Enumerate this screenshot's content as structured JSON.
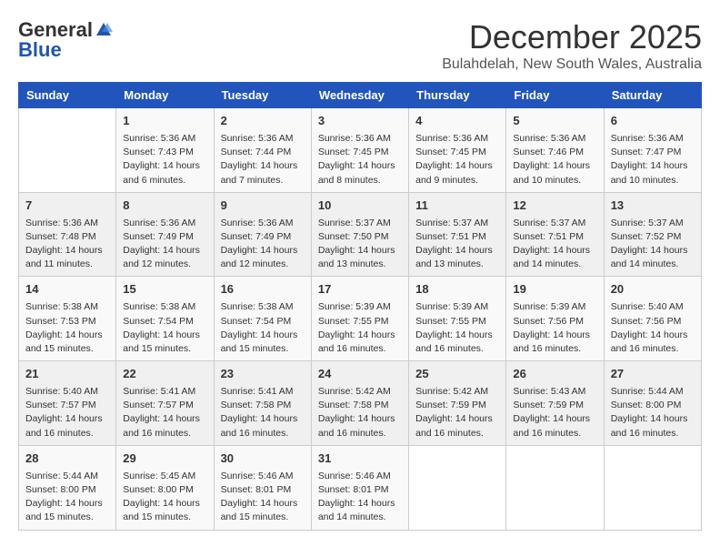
{
  "header": {
    "logo_general": "General",
    "logo_blue": "Blue",
    "month": "December 2025",
    "location": "Bulahdelah, New South Wales, Australia"
  },
  "days_of_week": [
    "Sunday",
    "Monday",
    "Tuesday",
    "Wednesday",
    "Thursday",
    "Friday",
    "Saturday"
  ],
  "weeks": [
    [
      {
        "day": "",
        "content": ""
      },
      {
        "day": "1",
        "content": "Sunrise: 5:36 AM\nSunset: 7:43 PM\nDaylight: 14 hours\nand 6 minutes."
      },
      {
        "day": "2",
        "content": "Sunrise: 5:36 AM\nSunset: 7:44 PM\nDaylight: 14 hours\nand 7 minutes."
      },
      {
        "day": "3",
        "content": "Sunrise: 5:36 AM\nSunset: 7:45 PM\nDaylight: 14 hours\nand 8 minutes."
      },
      {
        "day": "4",
        "content": "Sunrise: 5:36 AM\nSunset: 7:45 PM\nDaylight: 14 hours\nand 9 minutes."
      },
      {
        "day": "5",
        "content": "Sunrise: 5:36 AM\nSunset: 7:46 PM\nDaylight: 14 hours\nand 10 minutes."
      },
      {
        "day": "6",
        "content": "Sunrise: 5:36 AM\nSunset: 7:47 PM\nDaylight: 14 hours\nand 10 minutes."
      }
    ],
    [
      {
        "day": "7",
        "content": "Sunrise: 5:36 AM\nSunset: 7:48 PM\nDaylight: 14 hours\nand 11 minutes."
      },
      {
        "day": "8",
        "content": "Sunrise: 5:36 AM\nSunset: 7:49 PM\nDaylight: 14 hours\nand 12 minutes."
      },
      {
        "day": "9",
        "content": "Sunrise: 5:36 AM\nSunset: 7:49 PM\nDaylight: 14 hours\nand 12 minutes."
      },
      {
        "day": "10",
        "content": "Sunrise: 5:37 AM\nSunset: 7:50 PM\nDaylight: 14 hours\nand 13 minutes."
      },
      {
        "day": "11",
        "content": "Sunrise: 5:37 AM\nSunset: 7:51 PM\nDaylight: 14 hours\nand 13 minutes."
      },
      {
        "day": "12",
        "content": "Sunrise: 5:37 AM\nSunset: 7:51 PM\nDaylight: 14 hours\nand 14 minutes."
      },
      {
        "day": "13",
        "content": "Sunrise: 5:37 AM\nSunset: 7:52 PM\nDaylight: 14 hours\nand 14 minutes."
      }
    ],
    [
      {
        "day": "14",
        "content": "Sunrise: 5:38 AM\nSunset: 7:53 PM\nDaylight: 14 hours\nand 15 minutes."
      },
      {
        "day": "15",
        "content": "Sunrise: 5:38 AM\nSunset: 7:54 PM\nDaylight: 14 hours\nand 15 minutes."
      },
      {
        "day": "16",
        "content": "Sunrise: 5:38 AM\nSunset: 7:54 PM\nDaylight: 14 hours\nand 15 minutes."
      },
      {
        "day": "17",
        "content": "Sunrise: 5:39 AM\nSunset: 7:55 PM\nDaylight: 14 hours\nand 16 minutes."
      },
      {
        "day": "18",
        "content": "Sunrise: 5:39 AM\nSunset: 7:55 PM\nDaylight: 14 hours\nand 16 minutes."
      },
      {
        "day": "19",
        "content": "Sunrise: 5:39 AM\nSunset: 7:56 PM\nDaylight: 14 hours\nand 16 minutes."
      },
      {
        "day": "20",
        "content": "Sunrise: 5:40 AM\nSunset: 7:56 PM\nDaylight: 14 hours\nand 16 minutes."
      }
    ],
    [
      {
        "day": "21",
        "content": "Sunrise: 5:40 AM\nSunset: 7:57 PM\nDaylight: 14 hours\nand 16 minutes."
      },
      {
        "day": "22",
        "content": "Sunrise: 5:41 AM\nSunset: 7:57 PM\nDaylight: 14 hours\nand 16 minutes."
      },
      {
        "day": "23",
        "content": "Sunrise: 5:41 AM\nSunset: 7:58 PM\nDaylight: 14 hours\nand 16 minutes."
      },
      {
        "day": "24",
        "content": "Sunrise: 5:42 AM\nSunset: 7:58 PM\nDaylight: 14 hours\nand 16 minutes."
      },
      {
        "day": "25",
        "content": "Sunrise: 5:42 AM\nSunset: 7:59 PM\nDaylight: 14 hours\nand 16 minutes."
      },
      {
        "day": "26",
        "content": "Sunrise: 5:43 AM\nSunset: 7:59 PM\nDaylight: 14 hours\nand 16 minutes."
      },
      {
        "day": "27",
        "content": "Sunrise: 5:44 AM\nSunset: 8:00 PM\nDaylight: 14 hours\nand 16 minutes."
      }
    ],
    [
      {
        "day": "28",
        "content": "Sunrise: 5:44 AM\nSunset: 8:00 PM\nDaylight: 14 hours\nand 15 minutes."
      },
      {
        "day": "29",
        "content": "Sunrise: 5:45 AM\nSunset: 8:00 PM\nDaylight: 14 hours\nand 15 minutes."
      },
      {
        "day": "30",
        "content": "Sunrise: 5:46 AM\nSunset: 8:01 PM\nDaylight: 14 hours\nand 15 minutes."
      },
      {
        "day": "31",
        "content": "Sunrise: 5:46 AM\nSunset: 8:01 PM\nDaylight: 14 hours\nand 14 minutes."
      },
      {
        "day": "",
        "content": ""
      },
      {
        "day": "",
        "content": ""
      },
      {
        "day": "",
        "content": ""
      }
    ]
  ]
}
